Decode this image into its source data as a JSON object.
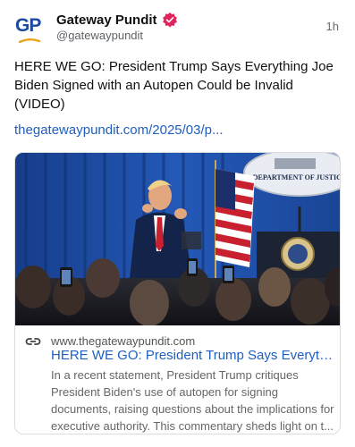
{
  "account": {
    "name": "Gateway Pundit",
    "handle": "@gatewaypundit",
    "avatar_text": "GP",
    "verified_icon": "verified-badge-icon",
    "time": "1h"
  },
  "post": {
    "text": "HERE WE GO: President Trump Says Everything Joe Biden Signed with an Autopen Could be Invalid (VIDEO)",
    "link": "thegatewaypundit.com/2025/03/p..."
  },
  "card": {
    "image_alt": "President Trump at Department of Justice podium with crowd",
    "seal_text": "DEPARTMENT OF JUSTICE",
    "domain": "www.thegatewaypundit.com",
    "title": "HERE WE GO: President Trump Says Everythin...",
    "description_lines": [
      "In a recent statement, President Trump critiques",
      "President Biden's use of autopen for signing",
      "documents, raising questions about the implications for",
      "executive authority. This commentary sheds light on t..."
    ],
    "link_icon": "link-icon"
  },
  "colors": {
    "link": "#1f5fbf",
    "verified": "#e0245e",
    "brand": "#1b4aa0"
  }
}
